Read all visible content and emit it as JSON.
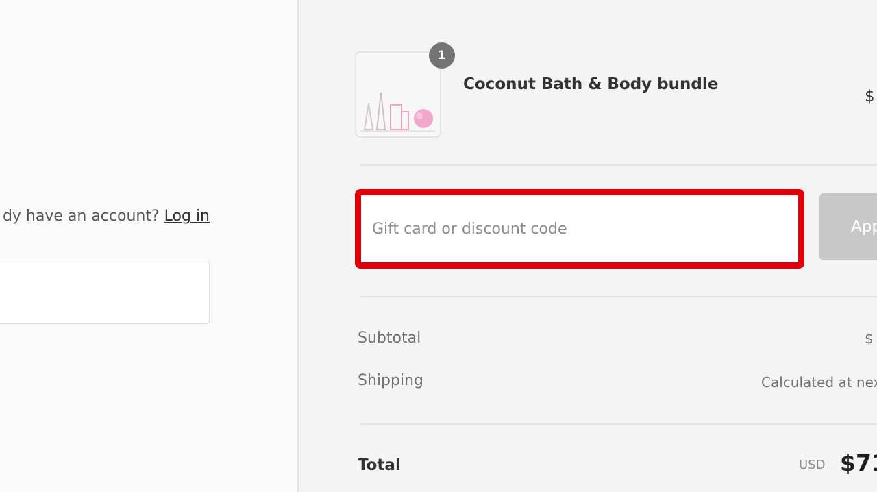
{
  "contact": {
    "account_prompt": "dy have an account?",
    "login_label": "Log in"
  },
  "cart": {
    "item": {
      "name": "Coconut Bath & Body bundle",
      "quantity": "1",
      "price": "$"
    }
  },
  "discount": {
    "placeholder": "Gift card or discount code",
    "value": "",
    "apply_label": "App",
    "highlight_color": "#e1000a"
  },
  "summary": {
    "subtotal_label": "Subtotal",
    "subtotal_value": "$",
    "shipping_label": "Shipping",
    "shipping_value": "Calculated at nex",
    "total_label": "Total",
    "currency": "USD",
    "total_value": "$71"
  }
}
